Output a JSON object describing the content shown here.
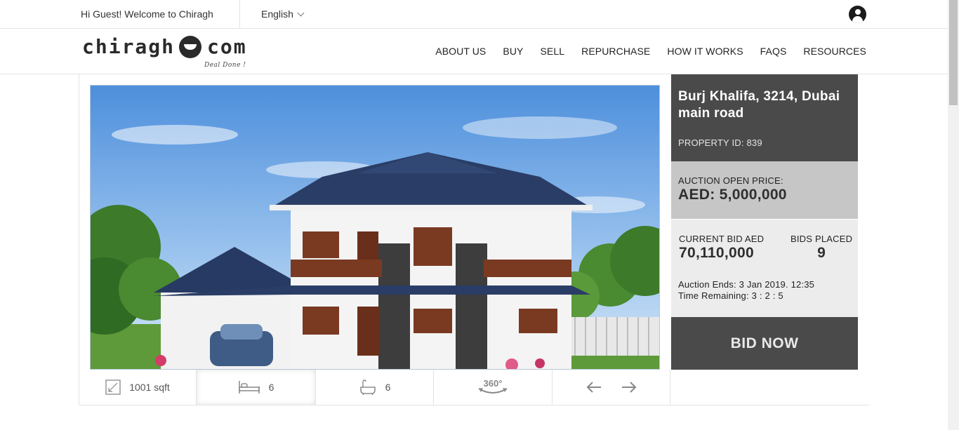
{
  "topbar": {
    "greeting": "Hi Guest! Welcome to Chiragh",
    "language": "English"
  },
  "logo": {
    "left_text": "chiragh",
    "right_text": "com",
    "tagline": "Deal Done !"
  },
  "nav": {
    "items": [
      "ABOUT US",
      "BUY",
      "SELL",
      "REPURCHASE",
      "HOW IT WORKS",
      "FAQS",
      "RESOURCES"
    ]
  },
  "property": {
    "title": "Burj Khalifa, 3214, Dubai main road",
    "property_id": "PROPERTY ID: 839",
    "open_price_label": "AUCTION OPEN PRICE:",
    "open_price_value": "AED: 5,000,000",
    "current_bid_label": "CURRENT BID AED",
    "current_bid_value": "70,110,000",
    "bids_placed_label": "BIDS PLACED",
    "bids_placed_value": "9",
    "auction_ends": "Auction Ends: 3 Jan 2019. 12:35",
    "time_remaining": "Time Remaining: 3 : 2 : 5",
    "bid_button": "BID NOW"
  },
  "features": {
    "area": "1001 sqft",
    "bedrooms": "6",
    "bathrooms": "6",
    "tour_label": "360°"
  },
  "icons": [
    "user-icon",
    "chevron-down-icon",
    "area-icon",
    "bed-icon",
    "bath-icon",
    "360-view-icon",
    "arrow-left-icon",
    "arrow-right-icon"
  ],
  "colors": {
    "panel_dark": "#4a4a4a",
    "panel_mid": "#c6c6c6",
    "panel_light": "#ececec"
  }
}
